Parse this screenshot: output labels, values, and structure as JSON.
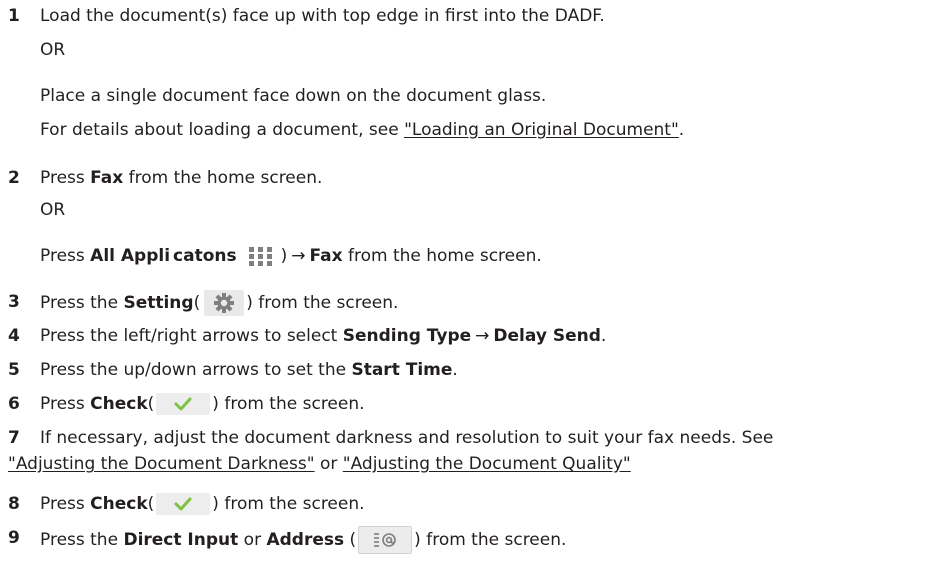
{
  "steps": {
    "s1": {
      "num": "1",
      "text": "Load the document(s) face up with top edge in first into the DADF.",
      "or": "OR",
      "alt": "Place a single document face down on the document glass.",
      "details_pre": "For details about loading a document, see ",
      "details_link": "\"Loading an Original Document\"",
      "details_post": "."
    },
    "s2": {
      "num": "2",
      "pre": "Press ",
      "bold": "Fax",
      "post": " from the home screen.",
      "or": "OR",
      "alt_pre": "Press ",
      "alt_bold1": "All Appli",
      "alt_bold2": "catons",
      "alt_close": ")",
      "alt_arrow": "→",
      "alt_bold3": "Fax",
      "alt_post": " from the home screen."
    },
    "s3": {
      "num": "3",
      "pre": "Press the ",
      "bold": "Setting",
      "open": "(",
      "close": ")",
      "post": " from the screen."
    },
    "s4": {
      "num": "4",
      "pre": "Press the left/right arrows to select ",
      "bold1": "Sending Type",
      "arrow": "→",
      "bold2": "Delay Send",
      "post": "."
    },
    "s5": {
      "num": "5",
      "pre": "Press the up/down arrows to set the ",
      "bold": "Start Time",
      "post": "."
    },
    "s6": {
      "num": "6",
      "pre": "Press ",
      "bold": "Check",
      "open": "(",
      "close": ")",
      "post": " from the screen."
    },
    "s7": {
      "num": "7",
      "line1": "If necessary, adjust the document darkness and resolution to suit your fax needs. See",
      "link1": "\"Adjusting the Document Darkness\"",
      "mid": " or ",
      "link2": "\"Adjusting the Document Quality\""
    },
    "s8": {
      "num": "8",
      "pre": "Press ",
      "bold": "Check",
      "open": "(",
      "close": ")",
      "post": " from the screen."
    },
    "s9": {
      "num": "9",
      "pre": "Press the ",
      "bold1": "Direct Input",
      "mid": " or ",
      "bold2": "Address",
      "open": " (",
      "close": ")",
      "post": " from the screen."
    }
  },
  "colors": {
    "text": "#231f20",
    "check": "#7dc242",
    "icon_gray": "#7f7f7f"
  },
  "icons": [
    "apps-icon",
    "gear-icon",
    "check-icon",
    "address-book-icon"
  ]
}
